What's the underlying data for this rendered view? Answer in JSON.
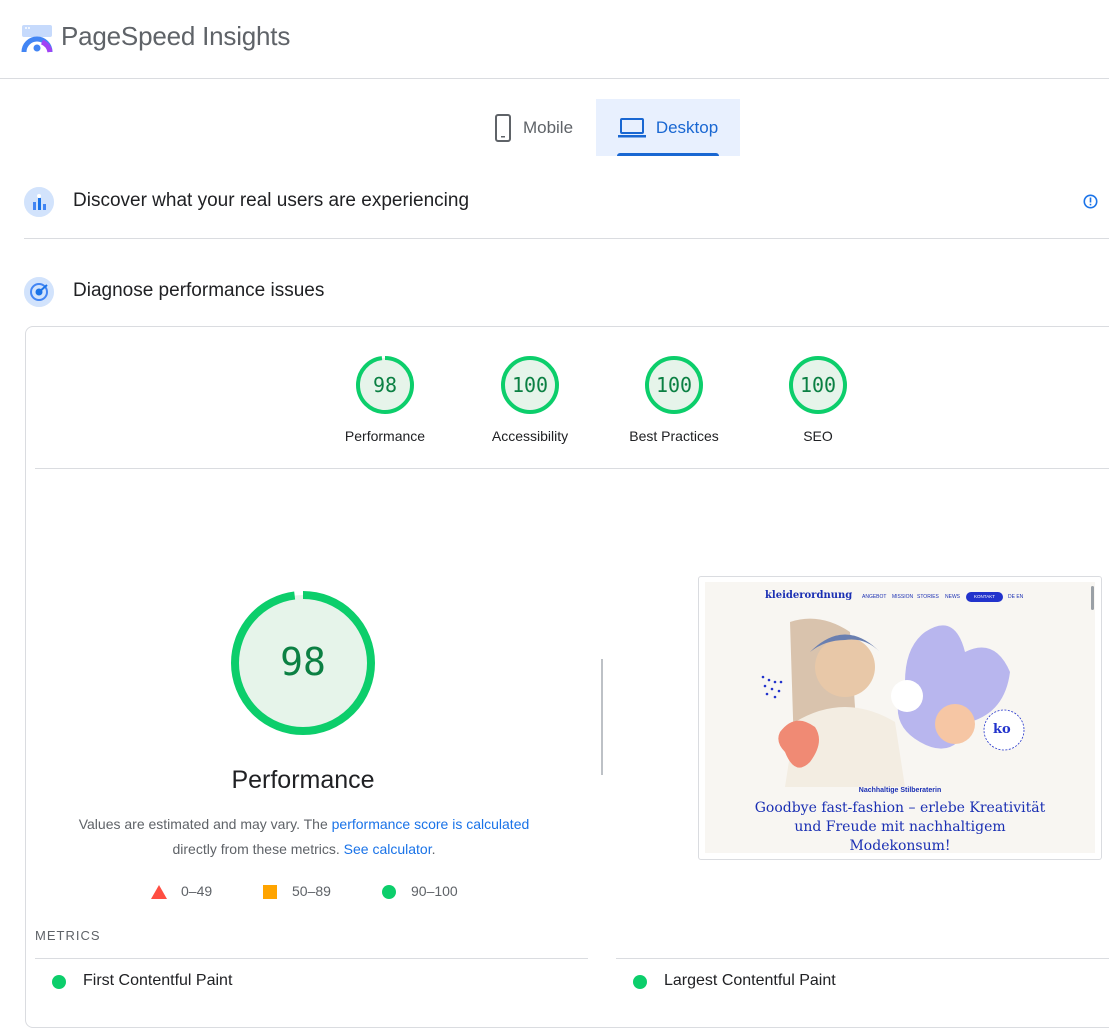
{
  "app": {
    "brand": "PageSpeed Insights"
  },
  "tabs": [
    {
      "label": "Mobile",
      "icon": "phone-icon",
      "selected": false
    },
    {
      "label": "Desktop",
      "icon": "laptop-icon",
      "selected": true
    }
  ],
  "sections": {
    "real_users": {
      "title": "Discover what your real users are experiencing",
      "info_icon": "info-icon"
    },
    "diagnose": {
      "title": "Diagnose performance issues"
    }
  },
  "scores": [
    {
      "label": "Performance",
      "value": "98"
    },
    {
      "label": "Accessibility",
      "value": "100"
    },
    {
      "label": "Best Practices",
      "value": "100"
    },
    {
      "label": "SEO",
      "value": "100"
    }
  ],
  "performance": {
    "score": "98",
    "title": "Performance",
    "desc_prefix": "Values are estimated and may vary. The ",
    "desc_link": "performance score is calculated",
    "desc_middle": "directly from these metrics. ",
    "calc_link": "See calculator",
    "desc_suffix": "."
  },
  "legend": [
    {
      "range": "0–49",
      "shape": "triangle",
      "color": "#ff4e42"
    },
    {
      "range": "50–89",
      "shape": "square",
      "color": "#ffa400"
    },
    {
      "range": "90–100",
      "shape": "circle",
      "color": "#0cce6b"
    }
  ],
  "metrics": {
    "heading": "METRICS",
    "items": [
      {
        "label": "First Contentful Paint"
      },
      {
        "label": "Largest Contentful Paint"
      }
    ]
  },
  "screenshot": {
    "site_logo": "kleiderordnung",
    "nav": [
      "ANGEBOT",
      "MISSION",
      "STORIES",
      "NEWS",
      "KONTAKT",
      "DE EN"
    ],
    "subtitle": "Nachhaltige Stilberaterin",
    "headline_1": "Goodbye fast-fashion – erlebe Kreativität",
    "headline_2": "und Freude mit nachhaltigem",
    "headline_3": "Modekonsum!",
    "badge": "ko"
  },
  "colors": {
    "accent": "#1a73e8",
    "pass": "#0cce6b",
    "pass_bg": "#e6f4ea"
  }
}
